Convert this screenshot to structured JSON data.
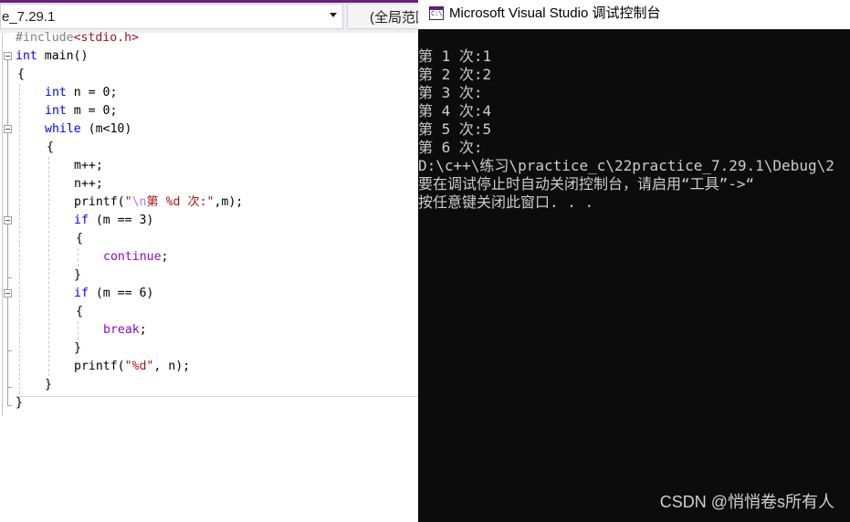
{
  "editor": {
    "project_combo": "e_7.29.1",
    "scope_combo": "(全局范围)",
    "code": {
      "l1": {
        "pp": "#include",
        "inc": "<stdio.h>"
      },
      "l2": {
        "kw": "int",
        "rest": " main()"
      },
      "l3": {
        "text": "{"
      },
      "l4": {
        "kw": "int",
        "rest": " n = 0;"
      },
      "l5": {
        "kw": "int",
        "rest": " m = 0;"
      },
      "l6": {
        "kw": "while",
        "rest": " (m<10)"
      },
      "l7": {
        "text": "{"
      },
      "l8": {
        "text": "m++;"
      },
      "l9": {
        "text": "n++;"
      },
      "l10": {
        "fn": "printf(",
        "q1": "\"",
        "esc": "\\n",
        "s1": "第 ",
        "fmt": "%d",
        "s2": " 次:\"",
        "tail": ",m);"
      },
      "l11": {
        "kw": "if",
        "rest": " (m == 3)"
      },
      "l12": {
        "text": "{"
      },
      "l13": {
        "kw": "continue",
        "rest": ";"
      },
      "l14": {
        "text": "}"
      },
      "l15": {
        "kw": "if",
        "rest": " (m == 6)"
      },
      "l16": {
        "text": "{"
      },
      "l17": {
        "kw": "break",
        "rest": ";"
      },
      "l18": {
        "text": "}"
      },
      "l19": {
        "fn": "printf(",
        "q1": "\"",
        "fmt": "%d",
        "q2": "\"",
        "tail": ", n);"
      },
      "l20": {
        "text": "}"
      },
      "l21": {
        "text": "}"
      }
    }
  },
  "console": {
    "title": "Microsoft Visual Studio 调试控制台",
    "icon_label": "C:\\",
    "lines": [
      "第 1 次:1",
      "第 2 次:2",
      "第 3 次:",
      "第 4 次:4",
      "第 5 次:5",
      "第 6 次:",
      "D:\\c++\\练习\\practice_c\\22practice_7.29.1\\Debug\\2",
      "要在调试停止时自动关闭控制台，请启用“工具”->“",
      "按任意键关闭此窗口. . ."
    ]
  },
  "watermark": "CSDN @悄悄卷s所有人",
  "colors": {
    "keyword": "#0000ff",
    "string": "#a31515",
    "escape": "#b776fb",
    "control_flow": "#8f08c4",
    "preprocessor": "#808080",
    "console_bg": "#0c0c0c",
    "console_fg": "#cccccc",
    "vs_accent": "#68217a"
  },
  "icons": [
    "console-app-icon",
    "fold-toggle-icon",
    "dropdown-arrow-icon"
  ]
}
